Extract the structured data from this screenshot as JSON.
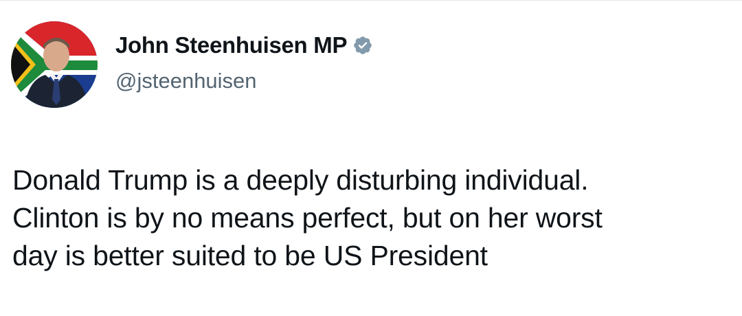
{
  "author": {
    "display_name": "John Steenhuisen MP",
    "handle": "@jsteenhuisen",
    "verified_icon": "verified-badge-icon",
    "verified_color": "#829aab"
  },
  "tweet": {
    "lines": [
      "Donald Trump is a deeply disturbing individual.",
      "Clinton is by no means perfect, but on her worst",
      "day is better suited to be US President"
    ]
  },
  "colors": {
    "text_primary": "#0f1419",
    "text_secondary": "#536471",
    "background": "#ffffff"
  }
}
